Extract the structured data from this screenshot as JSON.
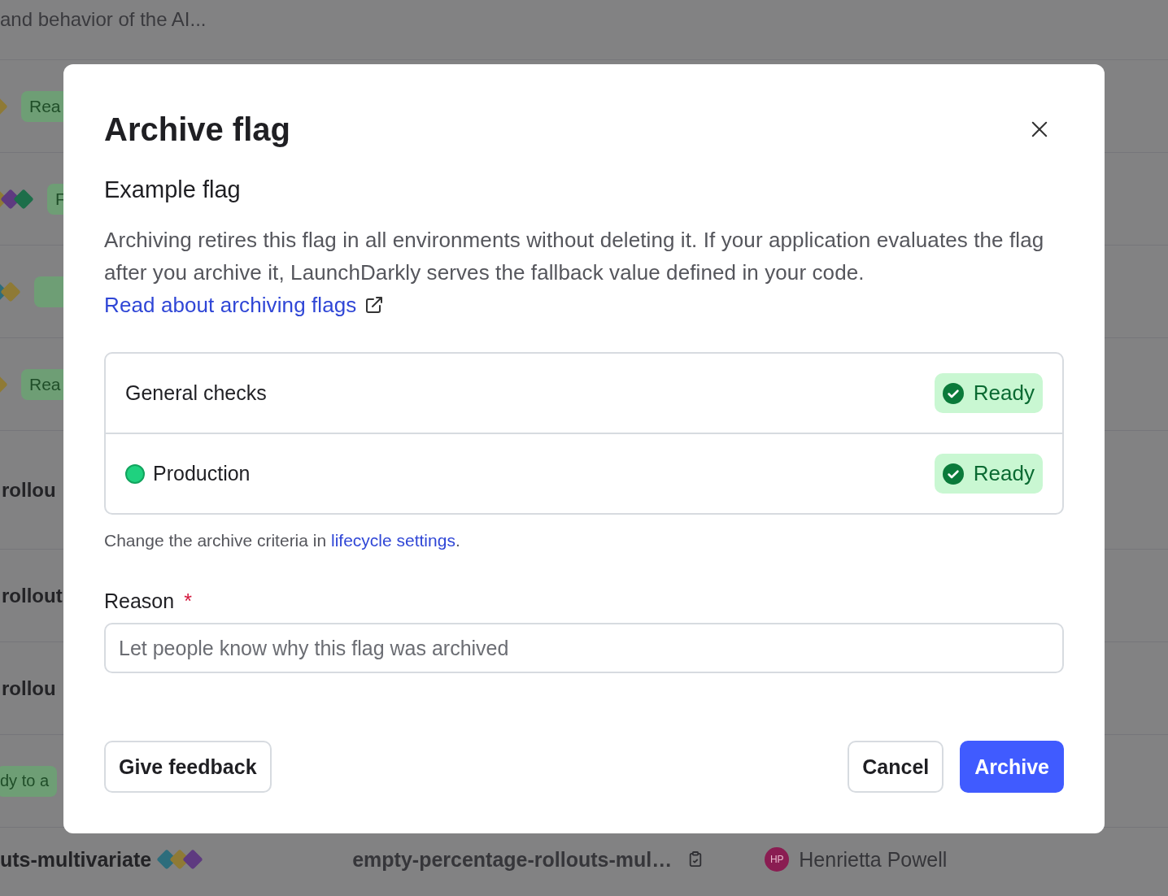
{
  "background_table": {
    "rows": [
      {
        "kind": "text",
        "text": "and behavior of the AI..."
      },
      {
        "kind": "badge",
        "diamonds": [
          {
            "color": "#8f7a35"
          }
        ],
        "badge": "Rea"
      },
      {
        "kind": "badge",
        "diamonds": [
          {
            "color": "#8f7a35"
          },
          {
            "color": "#5e3a80"
          },
          {
            "color": "#1d6e4a"
          }
        ],
        "badge": "F"
      },
      {
        "kind": "badge",
        "diamonds": [
          {
            "color": "#2d6d7c"
          },
          {
            "color": "#8f7a35"
          }
        ]
      },
      {
        "kind": "badge",
        "diamonds": [
          {
            "color": "#8f7a35"
          }
        ],
        "badge": "Rea"
      },
      {
        "kind": "name",
        "text": "rollou"
      },
      {
        "kind": "name",
        "text": "rollout"
      },
      {
        "kind": "name",
        "text": "rollou"
      },
      {
        "kind": "badge",
        "badge": "dy to a"
      },
      {
        "kind": "flag",
        "text": "uts-multivariate",
        "diamonds": [
          {
            "color": "#2d6d7c"
          },
          {
            "color": "#8f7a35"
          },
          {
            "color": "#5e3a80"
          }
        ],
        "key": "empty-percentage-rollouts-mul…",
        "avatar": "HP",
        "maintainer": "Henrietta Powell"
      }
    ]
  },
  "dialog": {
    "title": "Archive flag",
    "subtitle": "Example flag",
    "description": "Archiving retires this flag in all environments without deleting it. If your application evaluates the flag after you archive it, LaunchDarkly serves the fallback value defined in your code. ",
    "description_link": "Read about archiving flags",
    "checks": [
      {
        "kind": "general",
        "label": "General checks",
        "status": "Ready"
      },
      {
        "kind": "environment",
        "label": "Production",
        "color": "#1fd17f",
        "status": "Ready"
      }
    ],
    "criteria_text": "Change the archive criteria in ",
    "criteria_link": "lifecycle settings",
    "criteria_end": ".",
    "reason": {
      "label": "Reason",
      "required_mark": "*",
      "placeholder": "Let people know why this flag was archived"
    },
    "buttons": {
      "feedback": "Give feedback",
      "cancel": "Cancel",
      "confirm": "Archive"
    }
  }
}
